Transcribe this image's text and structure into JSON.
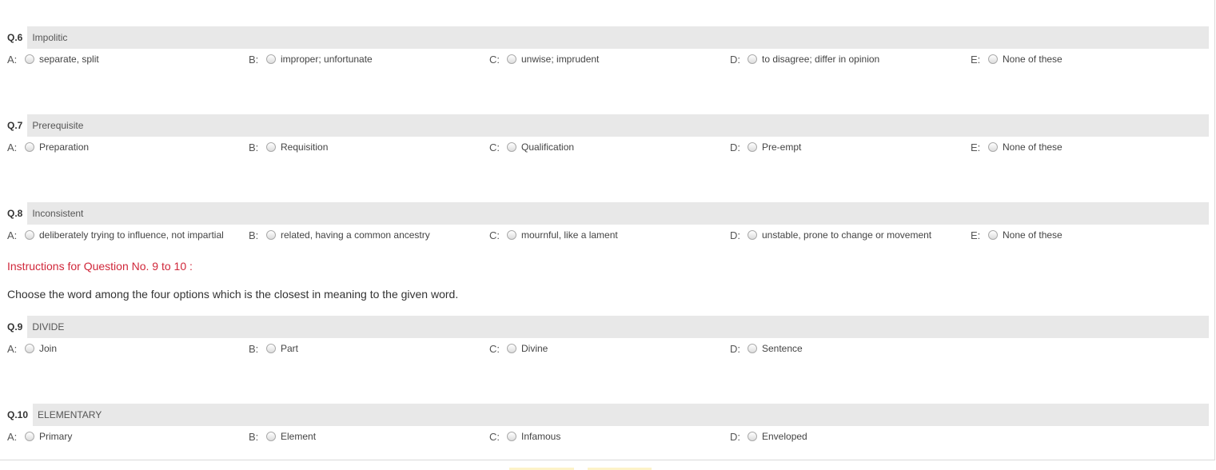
{
  "questions": [
    {
      "number": "Q.6",
      "text": "Impolitic",
      "options": [
        {
          "letter": "A:",
          "text": "separate, split"
        },
        {
          "letter": "B:",
          "text": "improper; unfortunate"
        },
        {
          "letter": "C:",
          "text": "unwise; imprudent"
        },
        {
          "letter": "D:",
          "text": "to disagree; differ in opinion"
        },
        {
          "letter": "E:",
          "text": "None of these"
        }
      ]
    },
    {
      "number": "Q.7",
      "text": "Prerequisite",
      "options": [
        {
          "letter": "A:",
          "text": "Preparation"
        },
        {
          "letter": "B:",
          "text": "Requisition"
        },
        {
          "letter": "C:",
          "text": "Qualification"
        },
        {
          "letter": "D:",
          "text": "Pre-empt"
        },
        {
          "letter": "E:",
          "text": "None of these"
        }
      ]
    },
    {
      "number": "Q.8",
      "text": "Inconsistent",
      "options": [
        {
          "letter": "A:",
          "text": "deliberately trying to influence, not impartial"
        },
        {
          "letter": "B:",
          "text": "related, having a common ancestry"
        },
        {
          "letter": "C:",
          "text": "mournful, like a lament"
        },
        {
          "letter": "D:",
          "text": "unstable, prone to change or movement"
        },
        {
          "letter": "E:",
          "text": "None of these"
        }
      ]
    },
    {
      "number": "Q.9",
      "text": "DIVIDE",
      "options": [
        {
          "letter": "A:",
          "text": "Join"
        },
        {
          "letter": "B:",
          "text": "Part"
        },
        {
          "letter": "C:",
          "text": "Divine"
        },
        {
          "letter": "D:",
          "text": "Sentence"
        }
      ]
    },
    {
      "number": "Q.10",
      "text": "ELEMENTARY",
      "options": [
        {
          "letter": "A:",
          "text": "Primary"
        },
        {
          "letter": "B:",
          "text": "Element"
        },
        {
          "letter": "C:",
          "text": "Infamous"
        },
        {
          "letter": "D:",
          "text": "Enveloped"
        }
      ]
    }
  ],
  "instructions": {
    "title": "Instructions for Question No. 9 to 10 :",
    "body": "Choose the word among the four options which is the closest in meaning to the given word."
  },
  "colors": {
    "instruction_red": "#d0273a",
    "header_bar": "#e8e8e8"
  }
}
